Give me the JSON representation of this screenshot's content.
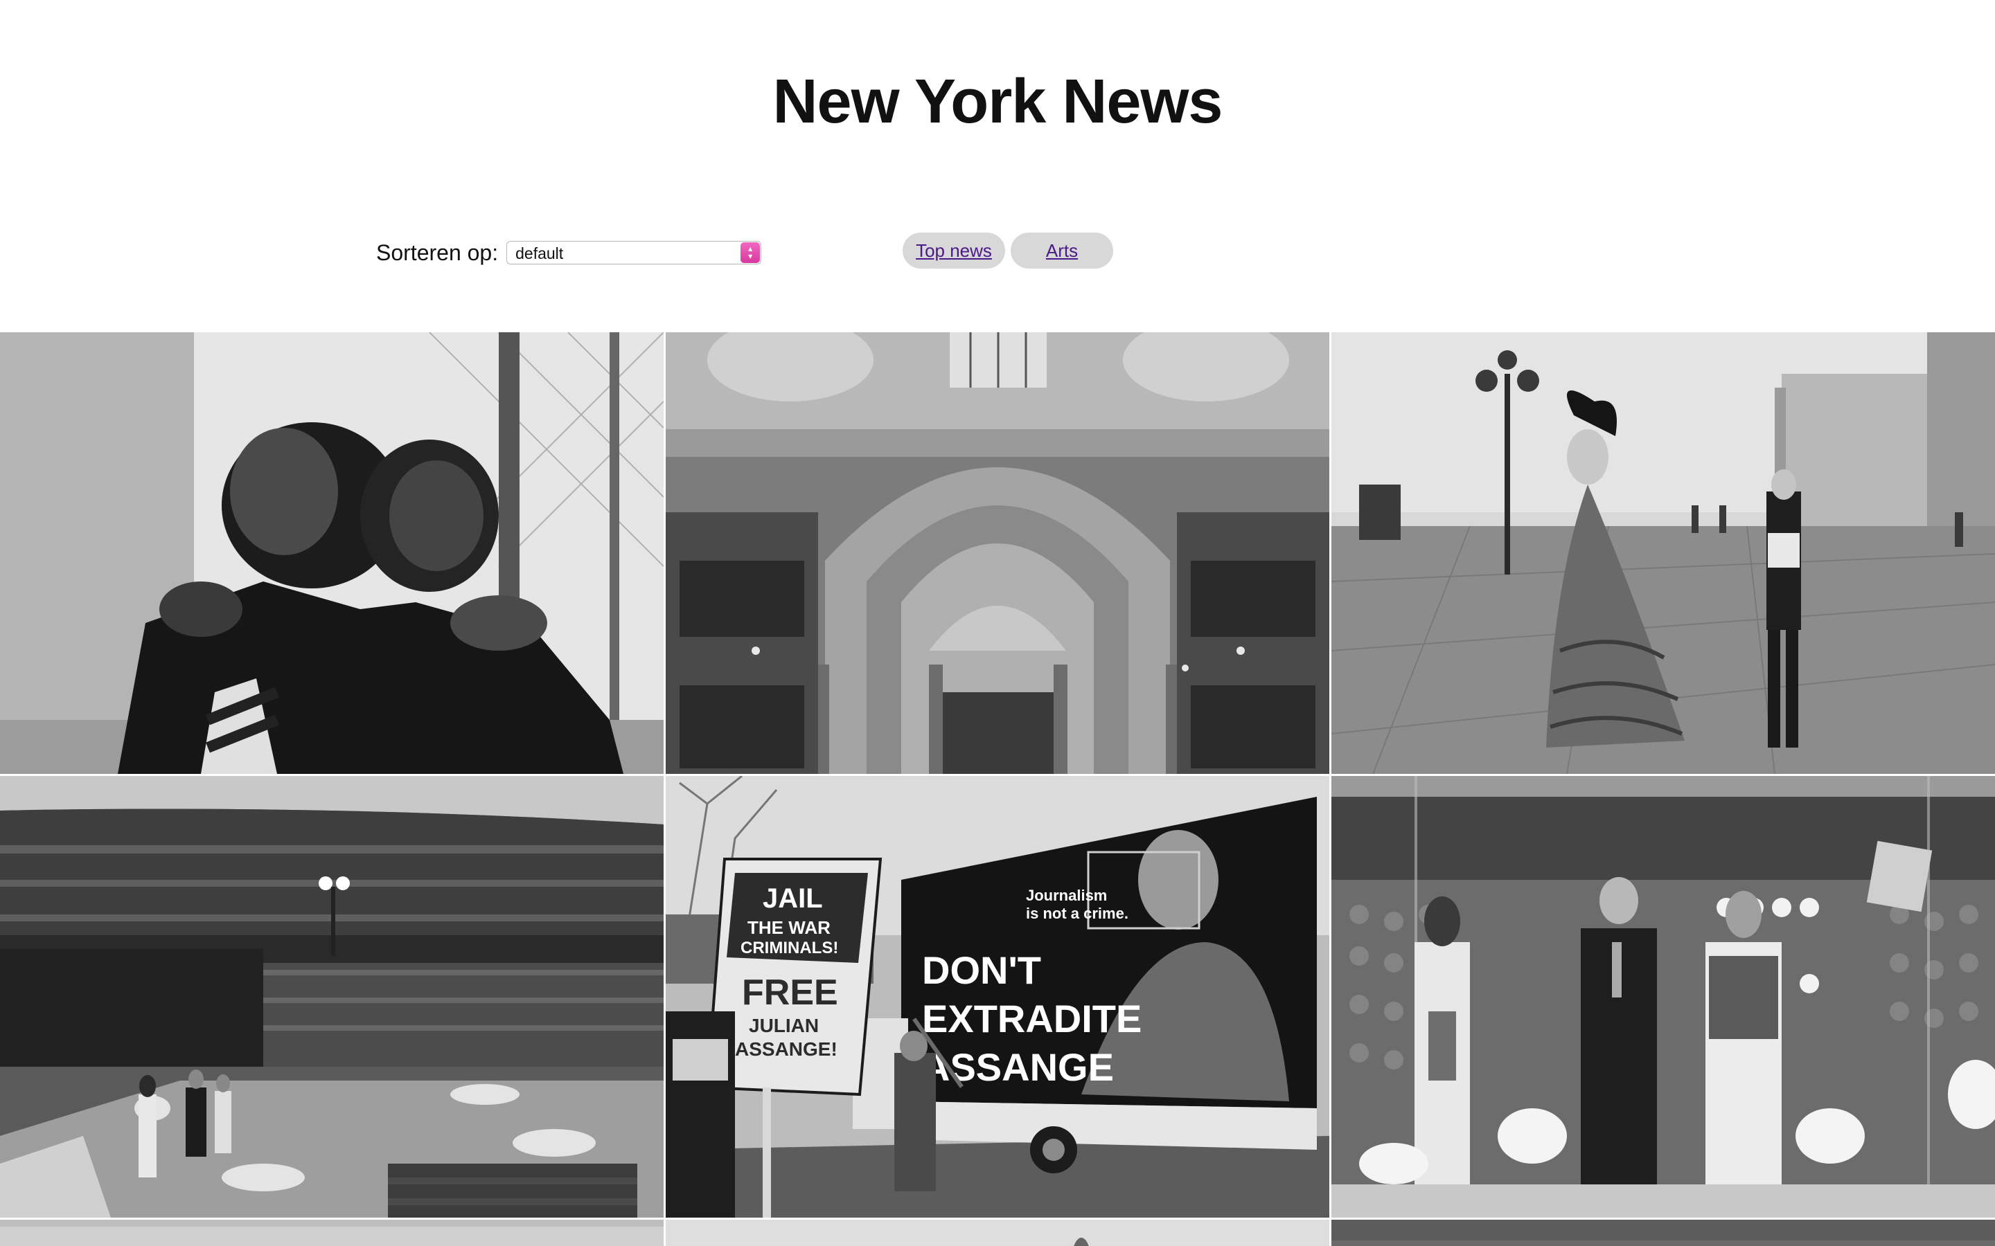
{
  "page": {
    "title": "New York News"
  },
  "controls": {
    "sort_label": "Sorteren op:",
    "sort_selected": "default"
  },
  "tabs": [
    {
      "label": "Top news"
    },
    {
      "label": "Arts"
    }
  ],
  "photo_signs": {
    "protest_sign_line1": "JAIL",
    "protest_sign_line2": "THE WAR",
    "protest_sign_line3": "CRIMINALS!",
    "protest_sign_line4": "FREE",
    "protest_sign_line5": "JULIAN",
    "protest_sign_line6": "ASSANGE!",
    "truck_line1": "DON'T",
    "truck_line2": "EXTRADITE",
    "truck_line3": "ASSANGE",
    "truck_small1": "Journalism",
    "truck_small2": "is not a crime."
  },
  "colors": {
    "select_arrow": "#e04aaf",
    "tab_bg": "#d8d8d8",
    "tab_link": "#4b1a8a"
  }
}
